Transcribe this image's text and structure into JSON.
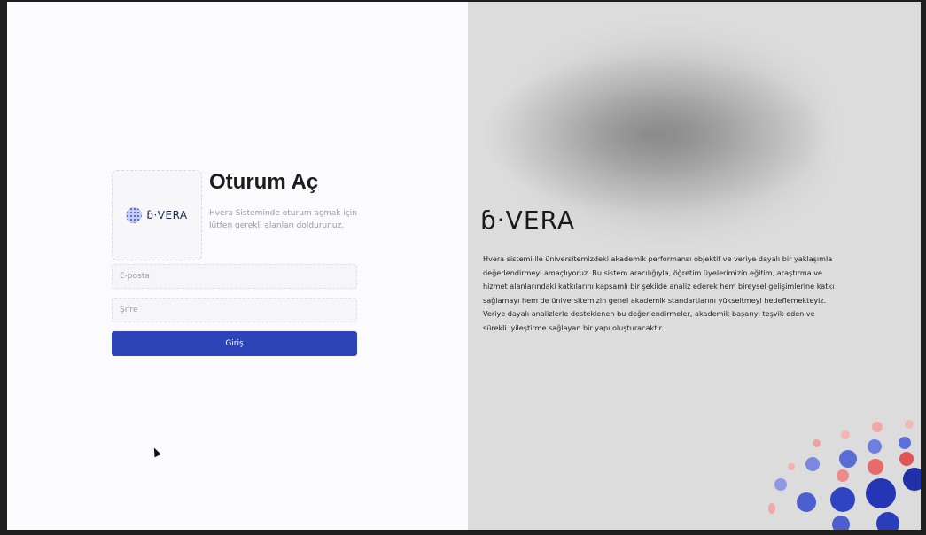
{
  "login": {
    "title": "Oturum Aç",
    "subtitle": "Hvera Sisteminde oturum açmak için lütfen gerekli alanları doldurunuz.",
    "email_placeholder": "E-posta",
    "password_placeholder": "Şifre",
    "submit_label": "Giriş"
  },
  "brand": {
    "logo_text": "ɓ·VERA",
    "big_logo_text": "ɓ·VERA",
    "description": "Hvera sistemi ile üniversitemizdeki akademik performansı objektif ve veriye dayalı bir yaklaşımla değerlendirmeyi amaçlıyoruz. Bu sistem aracılığıyla, öğretim üyelerimizin eğitim, araştırma ve hizmet alanlarındaki katkılarını kapsamlı bir şekilde analiz ederek hem bireysel gelişimlerine katkı sağlamayı hem de üniversitemizin genel akademik standartlarını yükseltmeyi hedeflemekteyiz. Veriye dayalı analizlerle desteklenen bu değerlendirmeler, akademik başarıyı teşvik eden ve sürekli iyileştirme sağlayan bir yapı oluşturacaktır."
  },
  "colors": {
    "primary_button": "#2e45b8",
    "dot_blue": "#2e45b8",
    "dot_red": "#e36b6b"
  }
}
